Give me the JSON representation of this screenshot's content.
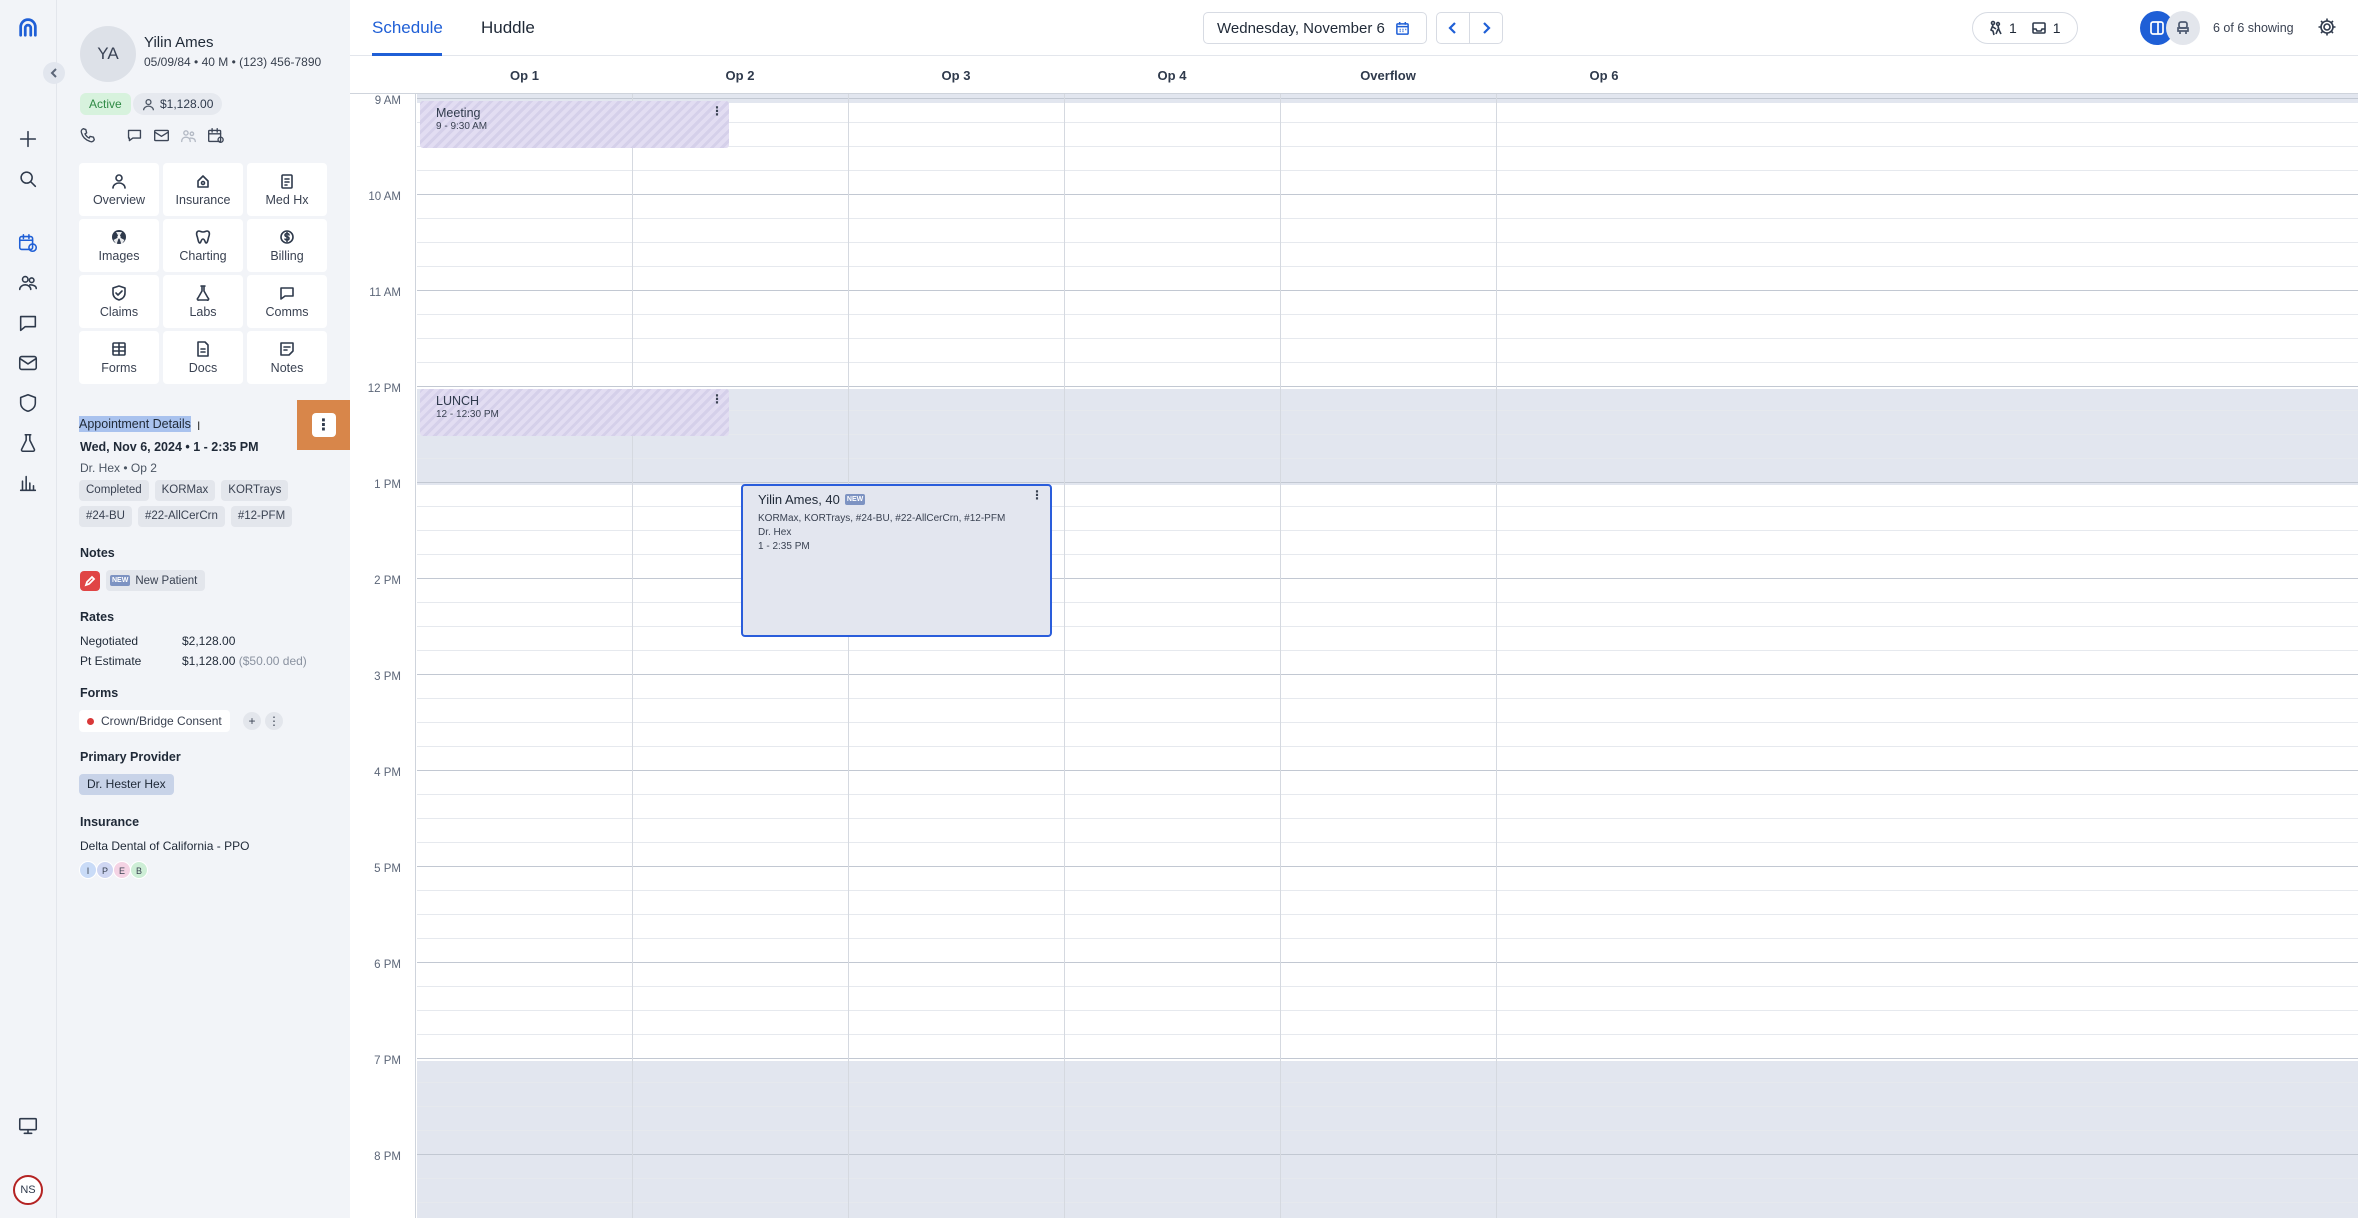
{
  "rail": {
    "user_initials": "NS"
  },
  "patient": {
    "initials": "YA",
    "name": "Yilin Ames",
    "meta": "05/09/84 • 40 M • (123) 456-7890",
    "status": "Active",
    "balance": "$1,128.00"
  },
  "tiles": [
    "Overview",
    "Insurance",
    "Med Hx",
    "Images",
    "Charting",
    "Billing",
    "Claims",
    "Labs",
    "Comms",
    "Forms",
    "Docs",
    "Notes"
  ],
  "appointment": {
    "title": "Appointment Details",
    "when": "Wed, Nov 6, 2024 • 1 - 2:35 PM",
    "provider_op": "Dr. Hex • Op 2",
    "chips_row1": [
      "Completed",
      "KORMax",
      "KORTrays"
    ],
    "chips_row2": [
      "#24-BU",
      "#22-AllCerCrn",
      "#12-PFM"
    ]
  },
  "notes": {
    "label": "Notes",
    "new_badge": "NEW",
    "chip": "New Patient"
  },
  "rates": {
    "label": "Rates",
    "negotiated_label": "Negotiated",
    "negotiated_value": "$2,128.00",
    "estimate_label": "Pt Estimate",
    "estimate_value": "$1,128.00",
    "estimate_ded": "($50.00 ded)"
  },
  "forms": {
    "label": "Forms",
    "item": "Crown/Bridge Consent",
    "add": "+",
    "more": "⋮"
  },
  "primary_provider": {
    "label": "Primary Provider",
    "name": "Dr. Hester Hex"
  },
  "insurance": {
    "label": "Insurance",
    "name": "Delta Dental of California - PPO",
    "badges": [
      {
        "letter": "I",
        "color": "#c9dbf7"
      },
      {
        "letter": "P",
        "color": "#cfd6f2"
      },
      {
        "letter": "E",
        "color": "#f4d3e4"
      },
      {
        "letter": "B",
        "color": "#cdeed6"
      }
    ]
  },
  "topbar": {
    "tab_schedule": "Schedule",
    "tab_huddle": "Huddle",
    "date": "Wednesday, November 6",
    "counter_a": "1",
    "counter_b": "1",
    "showing": "6 of 6 showing"
  },
  "columns": [
    "Op 1",
    "Op 2",
    "Op 3",
    "Op 4",
    "Overflow",
    "Op 6"
  ],
  "time_labels": [
    "9 AM",
    "10 AM",
    "11 AM",
    "12 PM",
    "1 PM",
    "2 PM",
    "3 PM",
    "4 PM",
    "5 PM",
    "6 PM",
    "7 PM",
    "8 PM"
  ],
  "blocks": {
    "meeting": {
      "title": "Meeting",
      "time": "9 - 9:30 AM"
    },
    "lunch": {
      "title": "LUNCH",
      "time": "12 - 12:30 PM"
    }
  },
  "appt_card": {
    "name": "Yilin Ames, 40",
    "badge": "NEW",
    "procedures": "KORMax, KORTrays, #24-BU, #22-AllCerCrn, #12-PFM",
    "provider": "Dr. Hex",
    "time": "1 - 2:35 PM"
  },
  "colors": {
    "accent": "#1f5fd6",
    "active_badge": "#d7f2dd",
    "highlight": "#d8864a"
  }
}
